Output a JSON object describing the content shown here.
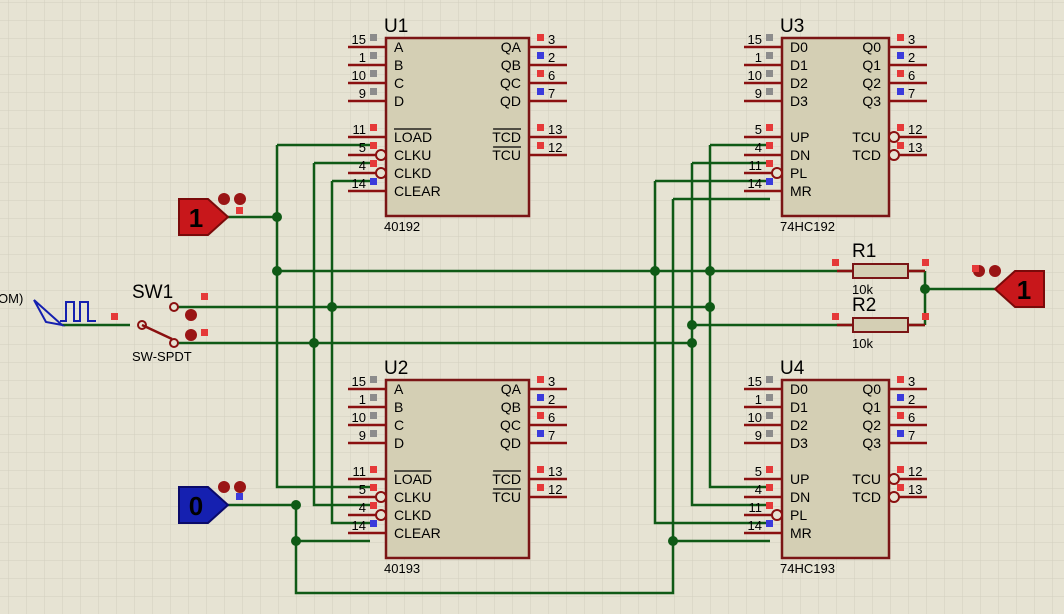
{
  "colors": {
    "background": "#e6e3d3",
    "grid": "#d2cfbf",
    "wire": "#0f5a16",
    "chip_fill": "#d4cfb4",
    "chip_border": "#7a1515",
    "pin_high": "#e53939",
    "pin_low": "#3b3bdb",
    "pin_float": "#8c8c8c",
    "logic_one": "#c8171b",
    "logic_zero": "#1520b0"
  },
  "chips": {
    "U1": {
      "ref": "U1",
      "type": "40192",
      "left": [
        {
          "pin": "15",
          "label": "A",
          "state": "float"
        },
        {
          "pin": "1",
          "label": "B",
          "state": "float"
        },
        {
          "pin": "10",
          "label": "C",
          "state": "float"
        },
        {
          "pin": "9",
          "label": "D",
          "state": "float"
        },
        {
          "pin": "11",
          "label": "LOAD",
          "state": "high",
          "overbar": true
        },
        {
          "pin": "5",
          "label": "CLKU",
          "state": "high",
          "bubble": true
        },
        {
          "pin": "4",
          "label": "CLKD",
          "state": "high",
          "bubble": true
        },
        {
          "pin": "14",
          "label": "CLEAR",
          "state": "low"
        }
      ],
      "right": [
        {
          "pin": "3",
          "label": "QA",
          "state": "high"
        },
        {
          "pin": "2",
          "label": "QB",
          "state": "low"
        },
        {
          "pin": "6",
          "label": "QC",
          "state": "high"
        },
        {
          "pin": "7",
          "label": "QD",
          "state": "low"
        },
        {
          "pin": "13",
          "label": "TCD",
          "state": "high",
          "overbar": true
        },
        {
          "pin": "12",
          "label": "TCU",
          "state": "high",
          "overbar": true
        }
      ]
    },
    "U2": {
      "ref": "U2",
      "type": "40193",
      "left": [
        {
          "pin": "15",
          "label": "A",
          "state": "float"
        },
        {
          "pin": "1",
          "label": "B",
          "state": "float"
        },
        {
          "pin": "10",
          "label": "C",
          "state": "float"
        },
        {
          "pin": "9",
          "label": "D",
          "state": "float"
        },
        {
          "pin": "11",
          "label": "LOAD",
          "state": "high",
          "overbar": true
        },
        {
          "pin": "5",
          "label": "CLKU",
          "state": "high",
          "bubble": true
        },
        {
          "pin": "4",
          "label": "CLKD",
          "state": "high",
          "bubble": true
        },
        {
          "pin": "14",
          "label": "CLEAR",
          "state": "low"
        }
      ],
      "right": [
        {
          "pin": "3",
          "label": "QA",
          "state": "high"
        },
        {
          "pin": "2",
          "label": "QB",
          "state": "low"
        },
        {
          "pin": "6",
          "label": "QC",
          "state": "high"
        },
        {
          "pin": "7",
          "label": "QD",
          "state": "low"
        },
        {
          "pin": "13",
          "label": "TCD",
          "state": "high",
          "overbar": true
        },
        {
          "pin": "12",
          "label": "TCU",
          "state": "high",
          "overbar": true
        }
      ]
    },
    "U3": {
      "ref": "U3",
      "type": "74HC192",
      "left": [
        {
          "pin": "15",
          "label": "D0",
          "state": "float"
        },
        {
          "pin": "1",
          "label": "D1",
          "state": "float"
        },
        {
          "pin": "10",
          "label": "D2",
          "state": "float"
        },
        {
          "pin": "9",
          "label": "D3",
          "state": "float"
        },
        {
          "pin": "5",
          "label": "UP",
          "state": "high"
        },
        {
          "pin": "4",
          "label": "DN",
          "state": "high"
        },
        {
          "pin": "11",
          "label": "PL",
          "state": "high",
          "bubble": true
        },
        {
          "pin": "14",
          "label": "MR",
          "state": "low"
        }
      ],
      "right": [
        {
          "pin": "3",
          "label": "Q0",
          "state": "high"
        },
        {
          "pin": "2",
          "label": "Q1",
          "state": "low"
        },
        {
          "pin": "6",
          "label": "Q2",
          "state": "high"
        },
        {
          "pin": "7",
          "label": "Q3",
          "state": "low"
        },
        {
          "pin": "12",
          "label": "TCU",
          "state": "high",
          "bubble": true
        },
        {
          "pin": "13",
          "label": "TCD",
          "state": "high",
          "bubble": true
        }
      ]
    },
    "U4": {
      "ref": "U4",
      "type": "74HC193",
      "left": [
        {
          "pin": "15",
          "label": "D0",
          "state": "float"
        },
        {
          "pin": "1",
          "label": "D1",
          "state": "float"
        },
        {
          "pin": "10",
          "label": "D2",
          "state": "float"
        },
        {
          "pin": "9",
          "label": "D3",
          "state": "float"
        },
        {
          "pin": "5",
          "label": "UP",
          "state": "high"
        },
        {
          "pin": "4",
          "label": "DN",
          "state": "high"
        },
        {
          "pin": "11",
          "label": "PL",
          "state": "high",
          "bubble": true
        },
        {
          "pin": "14",
          "label": "MR",
          "state": "low"
        }
      ],
      "right": [
        {
          "pin": "3",
          "label": "Q0",
          "state": "high"
        },
        {
          "pin": "2",
          "label": "Q1",
          "state": "low"
        },
        {
          "pin": "6",
          "label": "Q2",
          "state": "high"
        },
        {
          "pin": "7",
          "label": "Q3",
          "state": "low"
        },
        {
          "pin": "12",
          "label": "TCU",
          "state": "high",
          "bubble": true
        },
        {
          "pin": "13",
          "label": "TCD",
          "state": "high",
          "bubble": true
        }
      ]
    }
  },
  "logic_states": {
    "top_left": "1",
    "bottom_left": "0",
    "right": "1"
  },
  "switch": {
    "ref": "SW1",
    "type": "SW-SPDT"
  },
  "clock": {
    "label": "OM)"
  },
  "resistors": {
    "R1": {
      "ref": "R1",
      "value": "10k"
    },
    "R2": {
      "ref": "R2",
      "value": "10k"
    }
  }
}
